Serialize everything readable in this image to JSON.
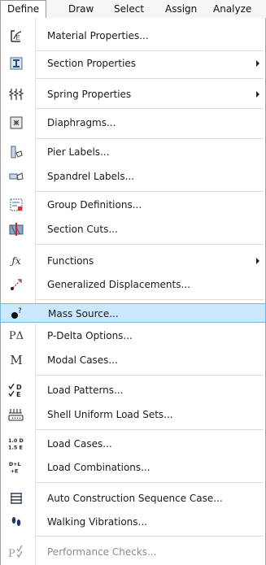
{
  "menubar": {
    "items": [
      "Define",
      "Draw",
      "Select",
      "Assign",
      "Analyze"
    ],
    "active": "Define"
  },
  "menu": {
    "items": [
      {
        "label": "Material Properties...",
        "icon": "material-properties-icon"
      },
      {
        "label": "Section Properties",
        "icon": "section-properties-icon",
        "submenu": true
      },
      {
        "label": "Spring Properties",
        "icon": "spring-properties-icon",
        "submenu": true
      },
      {
        "label": "Diaphragms...",
        "icon": "diaphragm-icon"
      },
      {
        "label": "Pier Labels...",
        "icon": "pier-labels-icon"
      },
      {
        "label": "Spandrel Labels...",
        "icon": "spandrel-labels-icon"
      },
      {
        "label": "Group Definitions...",
        "icon": "group-definitions-icon"
      },
      {
        "label": "Section Cuts...",
        "icon": "section-cuts-icon"
      },
      {
        "label": "Functions",
        "icon": "functions-icon",
        "submenu": true,
        "icon_text": "ƒx"
      },
      {
        "label": "Generalized Displacements...",
        "icon": "generalized-displacements-icon"
      },
      {
        "label": "Mass Source...",
        "icon": "mass-source-icon",
        "highlighted": true,
        "icon_text": "?"
      },
      {
        "label": "P-Delta Options...",
        "icon": "p-delta-icon",
        "icon_text": "PΔ"
      },
      {
        "label": "Modal Cases...",
        "icon": "modal-cases-icon",
        "icon_text": "M"
      },
      {
        "label": "Load Patterns...",
        "icon": "load-patterns-icon",
        "icon_text": "D E"
      },
      {
        "label": "Shell Uniform Load Sets...",
        "icon": "shell-uniform-load-sets-icon"
      },
      {
        "label": "Load Cases...",
        "icon": "load-cases-icon",
        "icon_text": "1.0 D 1.5 E"
      },
      {
        "label": "Load Combinations...",
        "icon": "load-combinations-icon",
        "icon_text": "D+L +E"
      },
      {
        "label": "Auto Construction Sequence Case...",
        "icon": "auto-construction-sequence-icon"
      },
      {
        "label": "Walking Vibrations...",
        "icon": "walking-vibrations-icon"
      },
      {
        "label": "Performance Checks...",
        "icon": "performance-checks-icon",
        "disabled": true
      }
    ]
  },
  "colors": {
    "highlight_bg": "#cce8ff",
    "highlight_border": "#7ab4e4",
    "menu_bg": "#ffffff",
    "separator": "#dcdcdc"
  }
}
